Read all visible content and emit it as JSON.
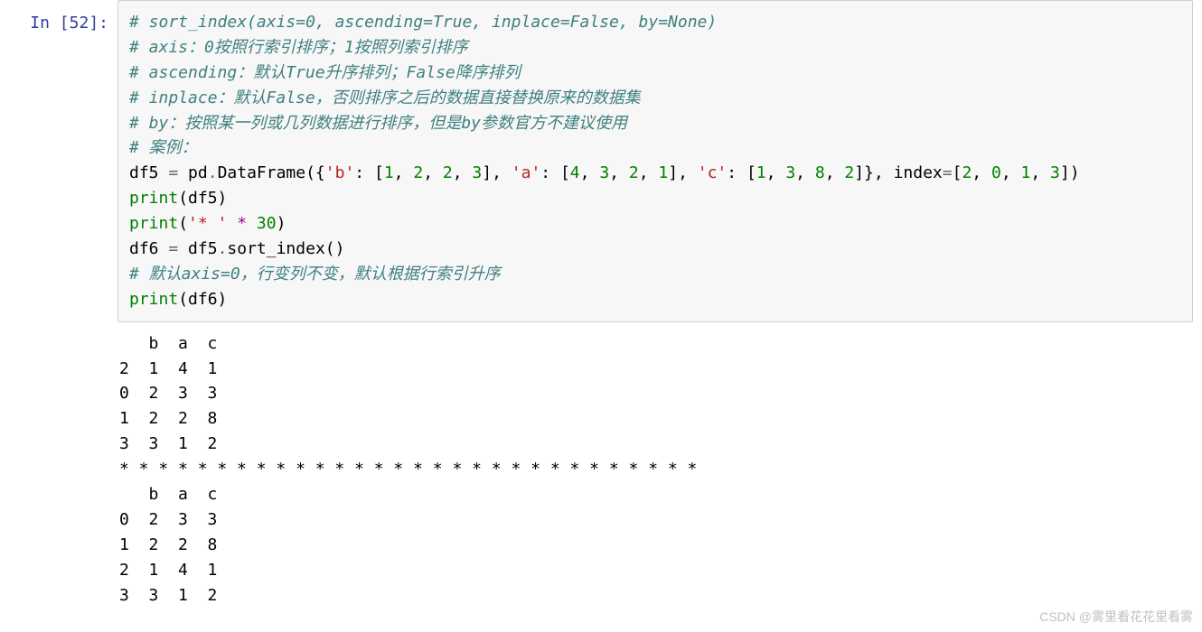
{
  "prompt": "In [52]:",
  "code": {
    "c1": "# sort_index(axis=0, ascending=True, inplace=False, by=None)",
    "c2": "# axis：0按照行索引排序；1按照列索引排序",
    "c3": "# ascending：默认True升序排列；False降序排列",
    "c4": "# inplace：默认False，否则排序之后的数据直接替换原来的数据集",
    "c5": "# by：按照某一列或几列数据进行排序，但是by参数官方不建议使用",
    "c6": "# 案例：",
    "l7": {
      "a": "df5 ",
      "eq": "=",
      "b": " pd",
      "dot": ".",
      "c": "DataFrame({",
      "s1": "'b'",
      "d": ": [",
      "n1": "1",
      "n2": "2",
      "n3": "2",
      "n4": "3",
      "e": "], ",
      "s2": "'a'",
      "f": ": [",
      "n5": "4",
      "n6": "3",
      "n7": "2",
      "n8": "1",
      "g": "], ",
      "s3": "'c'",
      "h": ": [",
      "n9": "1",
      "n10": "3",
      "n11": "8",
      "n12": "2",
      "i": "]}, index",
      "eq2": "=",
      "j": "[",
      "n13": "2",
      "n14": "0",
      "n15": "1",
      "n16": "3",
      "k": "])"
    },
    "l8": {
      "print": "print",
      "p1": "(df5)"
    },
    "l9": {
      "print": "print",
      "p1": "(",
      "s": "'* '",
      "sp": " ",
      "star": "*",
      "sp2": " ",
      "n": "30",
      "p2": ")"
    },
    "l10": {
      "a": "df6 ",
      "eq": "=",
      "b": " df5",
      "dot": ".",
      "c": "sort_index()"
    },
    "c11": "# 默认axis=0，行变列不变，默认根据行索引升序",
    "l12": {
      "print": "print",
      "p1": "(df6)"
    }
  },
  "output_lines": [
    "   b  a  c",
    "2  1  4  1",
    "0  2  3  3",
    "1  2  2  8",
    "3  3  1  2",
    "* * * * * * * * * * * * * * * * * * * * * * * * * * * * * * ",
    "   b  a  c",
    "0  2  3  3",
    "1  2  2  8",
    "2  1  4  1",
    "3  3  1  2"
  ],
  "watermark": "CSDN @雾里看花花里看雾",
  "chart_data": {
    "type": "table",
    "df5": {
      "columns": [
        "b",
        "a",
        "c"
      ],
      "index": [
        2,
        0,
        1,
        3
      ],
      "rows": [
        [
          1,
          4,
          1
        ],
        [
          2,
          3,
          3
        ],
        [
          2,
          2,
          8
        ],
        [
          3,
          1,
          2
        ]
      ]
    },
    "df6_sorted": {
      "columns": [
        "b",
        "a",
        "c"
      ],
      "index": [
        0,
        1,
        2,
        3
      ],
      "rows": [
        [
          2,
          3,
          3
        ],
        [
          2,
          2,
          8
        ],
        [
          1,
          4,
          1
        ],
        [
          3,
          1,
          2
        ]
      ]
    },
    "separator": "* * * * * * * * * * * * * * * * * * * * * * * * * * * * * * "
  }
}
